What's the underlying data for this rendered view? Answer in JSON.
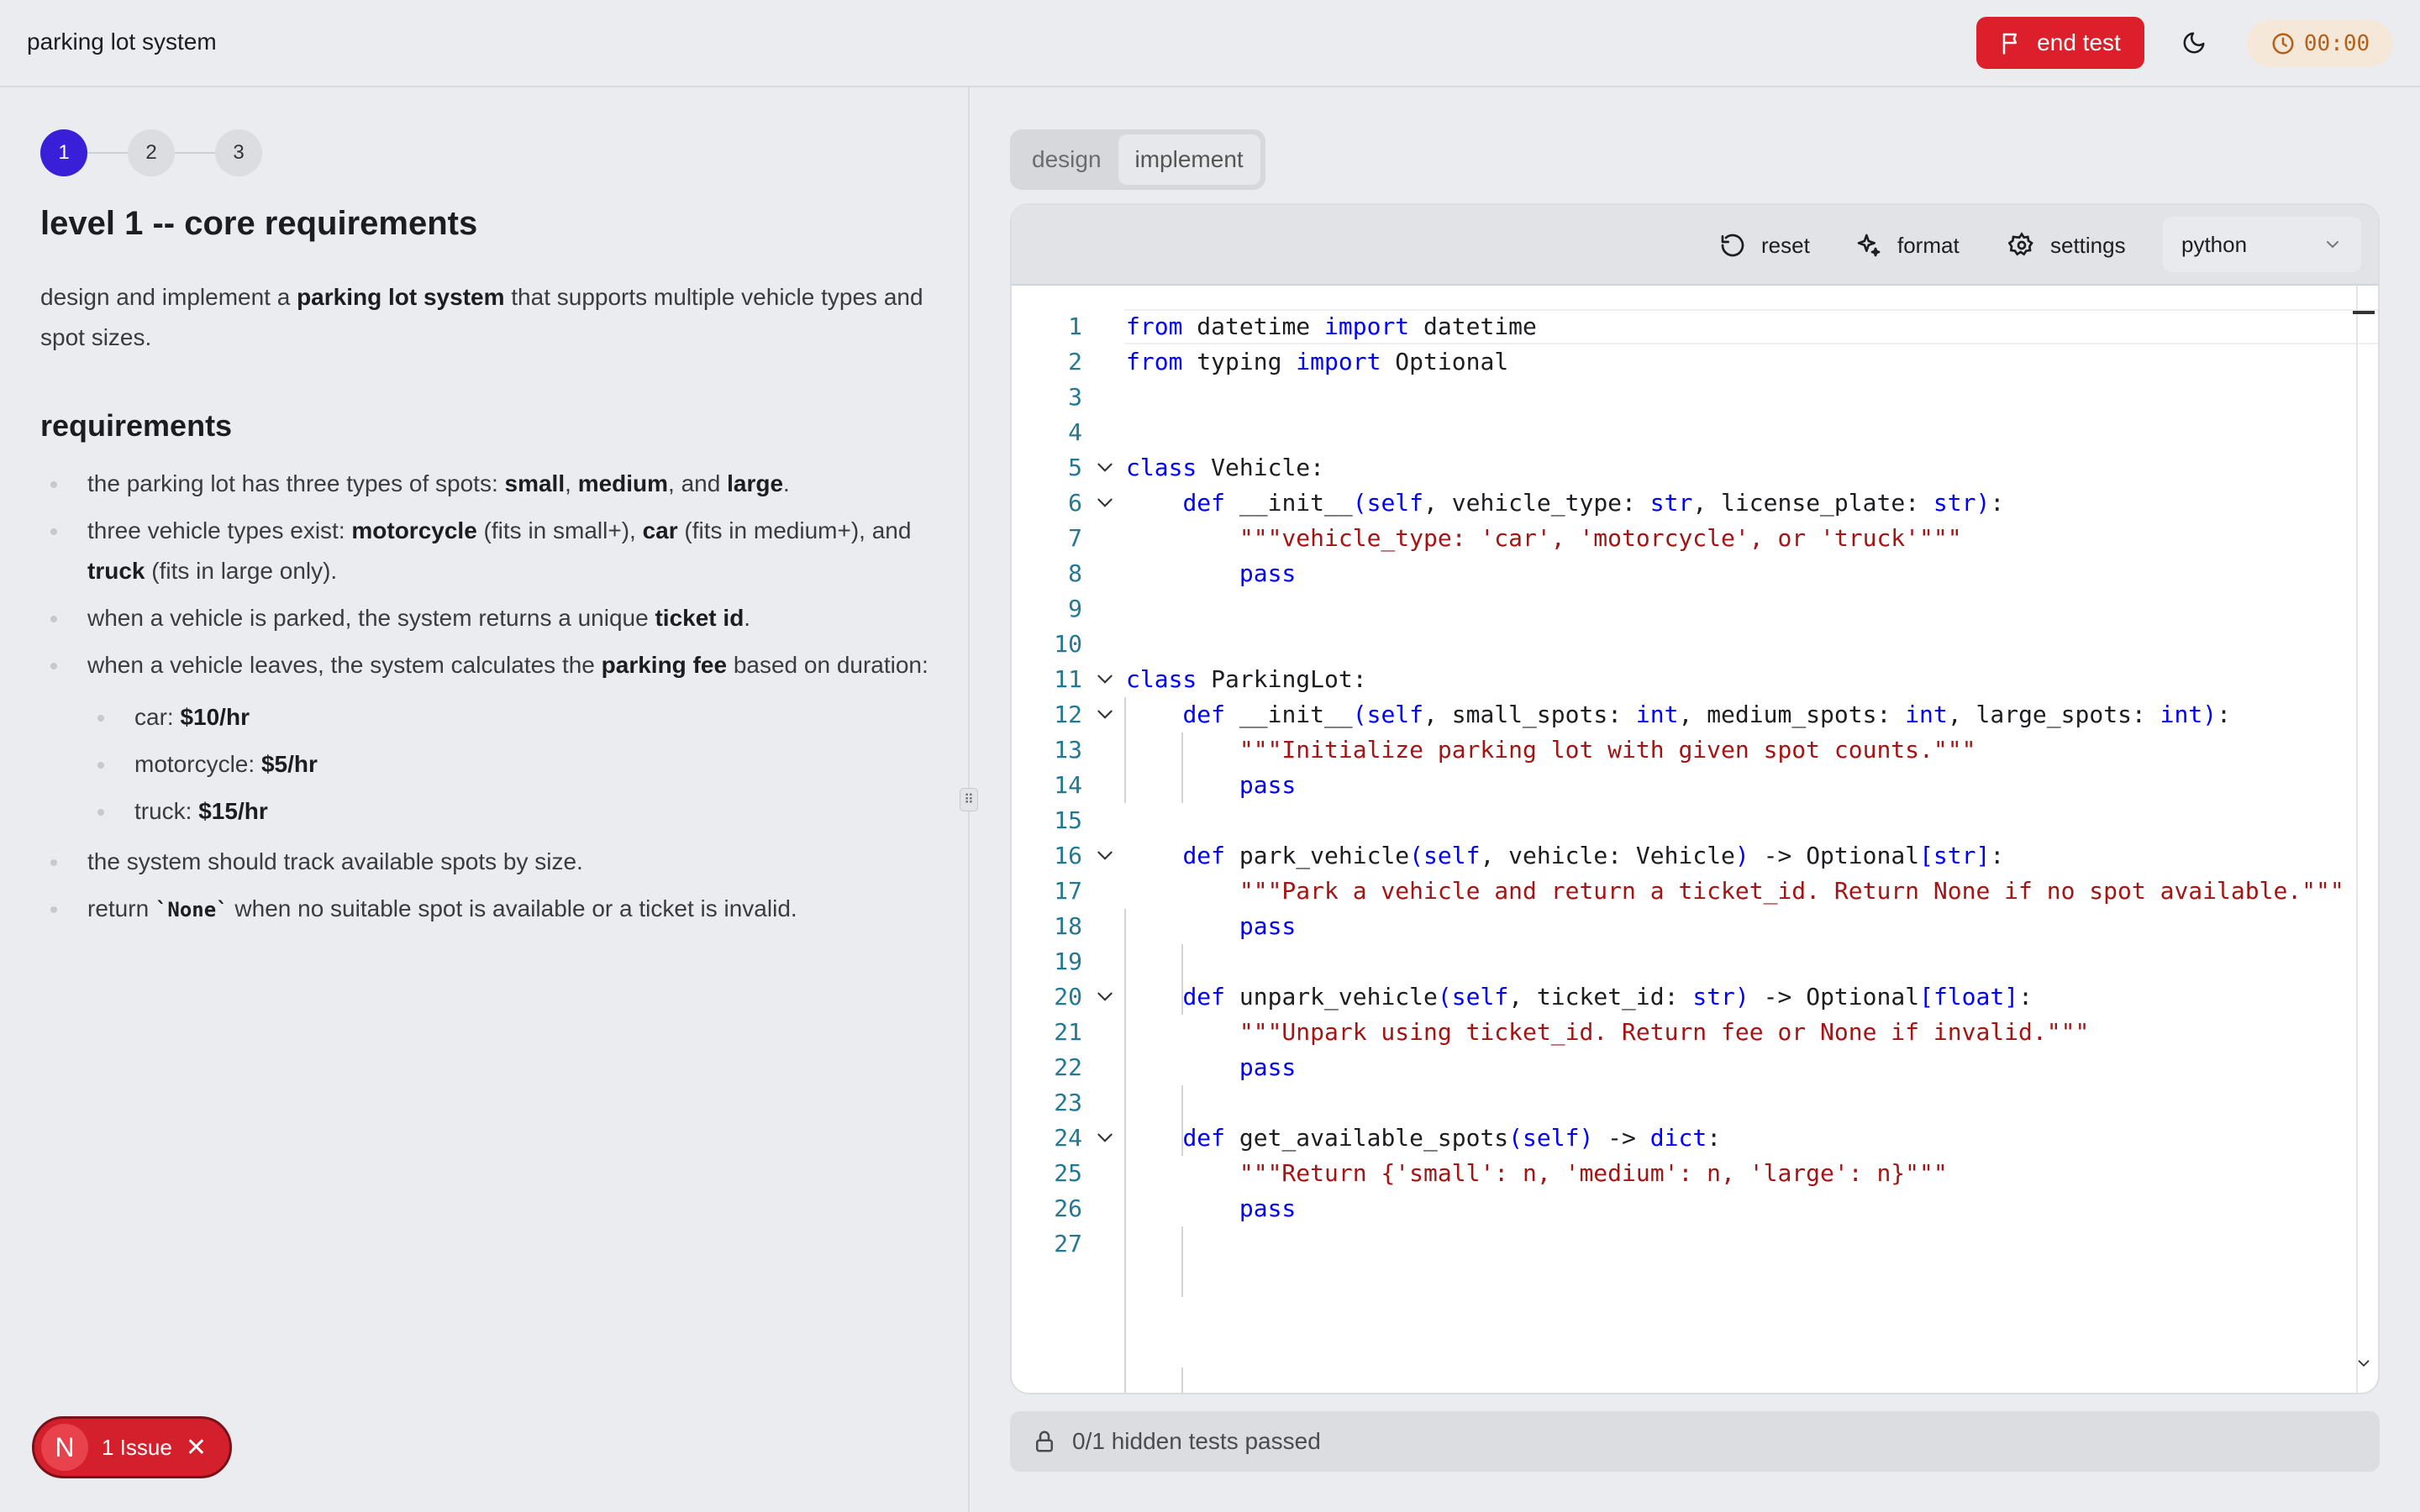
{
  "header": {
    "title": "parking lot system",
    "end_test_label": "end test",
    "timer": "00:00"
  },
  "left": {
    "steps": [
      "1",
      "2",
      "3"
    ],
    "level_title": "level 1 -- core requirements",
    "intro": {
      "pre": "design and implement a ",
      "bold": "parking lot system",
      "post": " that supports multiple vehicle types and spot sizes."
    },
    "requirements_heading": "requirements",
    "req1": {
      "a": "the parking lot has three types of spots: ",
      "b1": "small",
      "c": ", ",
      "b2": "medium",
      "d": ", and ",
      "b3": "large",
      "e": "."
    },
    "req2": {
      "a": "three vehicle types exist: ",
      "b1": "motorcycle",
      "c": " (fits in small+), ",
      "b2": "car",
      "d": " (fits in medium+), and ",
      "b3": "truck",
      "e": " (fits in large only)."
    },
    "req3": {
      "a": "when a vehicle is parked, the system returns a unique ",
      "b": "ticket id",
      "c": "."
    },
    "req4": {
      "a": "when a vehicle leaves, the system calculates the ",
      "b": "parking fee",
      "c": " based on duration:"
    },
    "fees": [
      {
        "label": "car: ",
        "value": "$10/hr"
      },
      {
        "label": "motorcycle: ",
        "value": "$5/hr"
      },
      {
        "label": "truck: ",
        "value": "$15/hr"
      }
    ],
    "req5": "the system should track available spots by size.",
    "req6": {
      "a": "return ",
      "code": "`None`",
      "b": " when no suitable spot is available or a ticket is invalid."
    }
  },
  "issue": {
    "avatar": "N",
    "label": "1 Issue",
    "close": "✕"
  },
  "right": {
    "tabs": [
      "design",
      "implement"
    ],
    "active_tab": "implement",
    "toolbar": {
      "reset": "reset",
      "format": "format",
      "settings": "settings",
      "language": "python"
    },
    "code_lines": [
      "from datetime import datetime",
      "from typing import Optional",
      "",
      "",
      "class Vehicle:",
      "    def __init__(self, vehicle_type: str, license_plate: str):",
      "        \"\"\"vehicle_type: 'car', 'motorcycle', or 'truck'\"\"\"",
      "        pass",
      "",
      "",
      "class ParkingLot:",
      "    def __init__(self, small_spots: int, medium_spots: int, large_spots: int):",
      "        \"\"\"Initialize parking lot with given spot counts.\"\"\"",
      "        pass",
      "",
      "    def park_vehicle(self, vehicle: Vehicle) -> Optional[str]:",
      "        \"\"\"Park a vehicle and return a ticket_id. Return None if no spot available.\"\"\"",
      "        pass",
      "",
      "    def unpark_vehicle(self, ticket_id: str) -> Optional[float]:",
      "        \"\"\"Unpark using ticket_id. Return fee or None if invalid.\"\"\"",
      "        pass",
      "",
      "    def get_available_spots(self) -> dict:",
      "        \"\"\"Return {'small': n, 'medium': n, 'large': n}\"\"\"",
      "        pass",
      ""
    ],
    "fold_lines": [
      5,
      6,
      11,
      12,
      16,
      20,
      24
    ],
    "tests_status": "0/1 hidden tests passed"
  }
}
